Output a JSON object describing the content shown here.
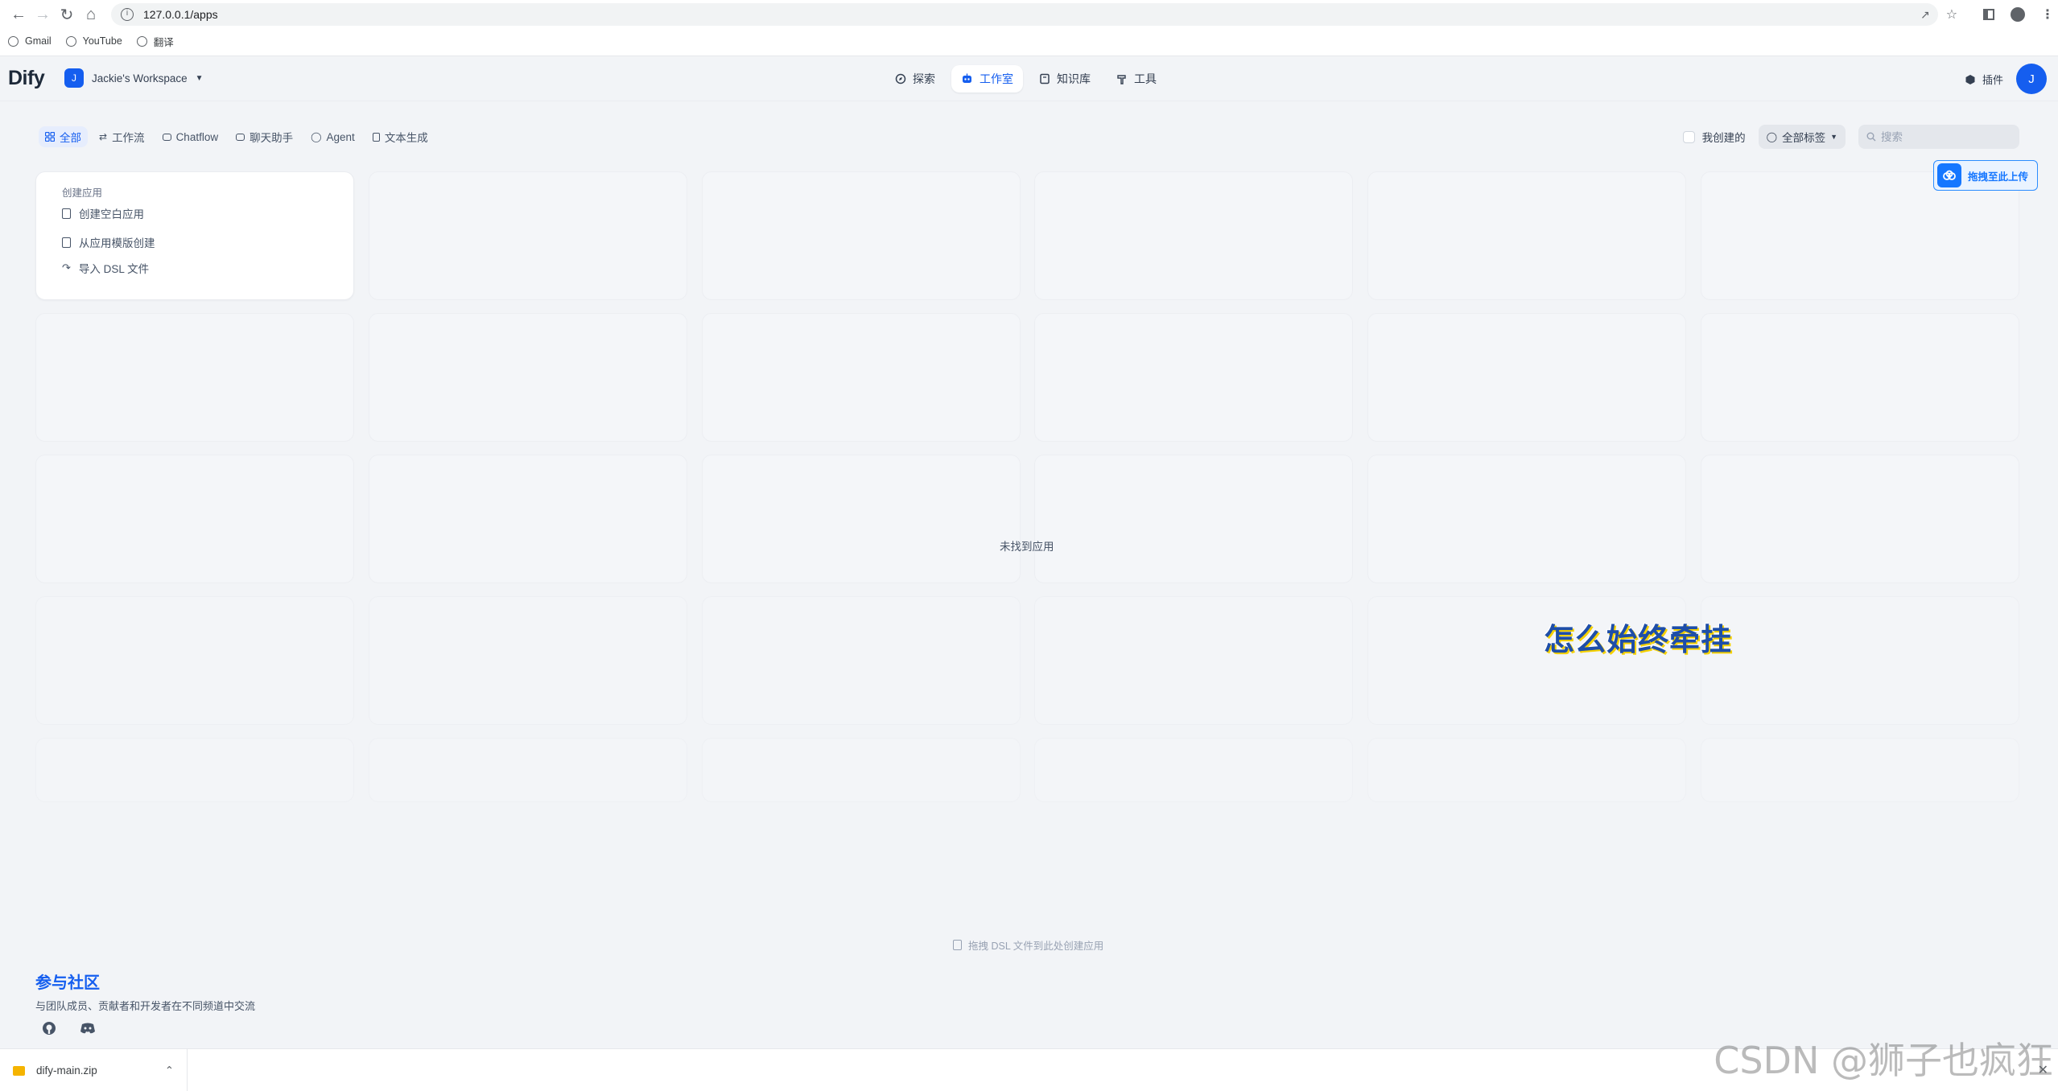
{
  "browser": {
    "url": "127.0.0.1/apps",
    "bookmarks": [
      {
        "label": "Gmail"
      },
      {
        "label": "YouTube"
      },
      {
        "label": "翻译"
      }
    ]
  },
  "header": {
    "logo": "Dify",
    "workspace": {
      "avatar": "J",
      "name": "Jackie's Workspace"
    },
    "nav": [
      {
        "label": "探索",
        "icon": "compass-icon"
      },
      {
        "label": "工作室",
        "icon": "robot-icon"
      },
      {
        "label": "知识库",
        "icon": "book-icon"
      },
      {
        "label": "工具",
        "icon": "hammer-icon"
      }
    ],
    "plugin_label": "插件",
    "user_avatar": "J"
  },
  "filters": {
    "tabs": [
      {
        "label": "全部"
      },
      {
        "label": "工作流"
      },
      {
        "label": "Chatflow"
      },
      {
        "label": "聊天助手"
      },
      {
        "label": "Agent"
      },
      {
        "label": "文本生成"
      }
    ],
    "created_by_me": "我创建的",
    "tag_select": "全部标签",
    "search_placeholder": "搜索"
  },
  "create_card": {
    "title": "创建应用",
    "items": [
      {
        "label": "创建空白应用"
      },
      {
        "label": "从应用模版创建"
      },
      {
        "label": "导入 DSL 文件"
      }
    ]
  },
  "empty_message": "未找到应用",
  "float_upload": "拖拽至此上传",
  "overlay_text": "怎么始终牵挂",
  "drop_hint": "拖拽 DSL 文件到此处创建应用",
  "community": {
    "title": "参与社区",
    "description": "与团队成员、贡献者和开发者在不同频道中交流"
  },
  "download": {
    "file": "dify-main.zip"
  },
  "watermark": "CSDN @狮子也疯狂",
  "colors": {
    "accent": "#155eef",
    "background": "#f2f4f7"
  }
}
